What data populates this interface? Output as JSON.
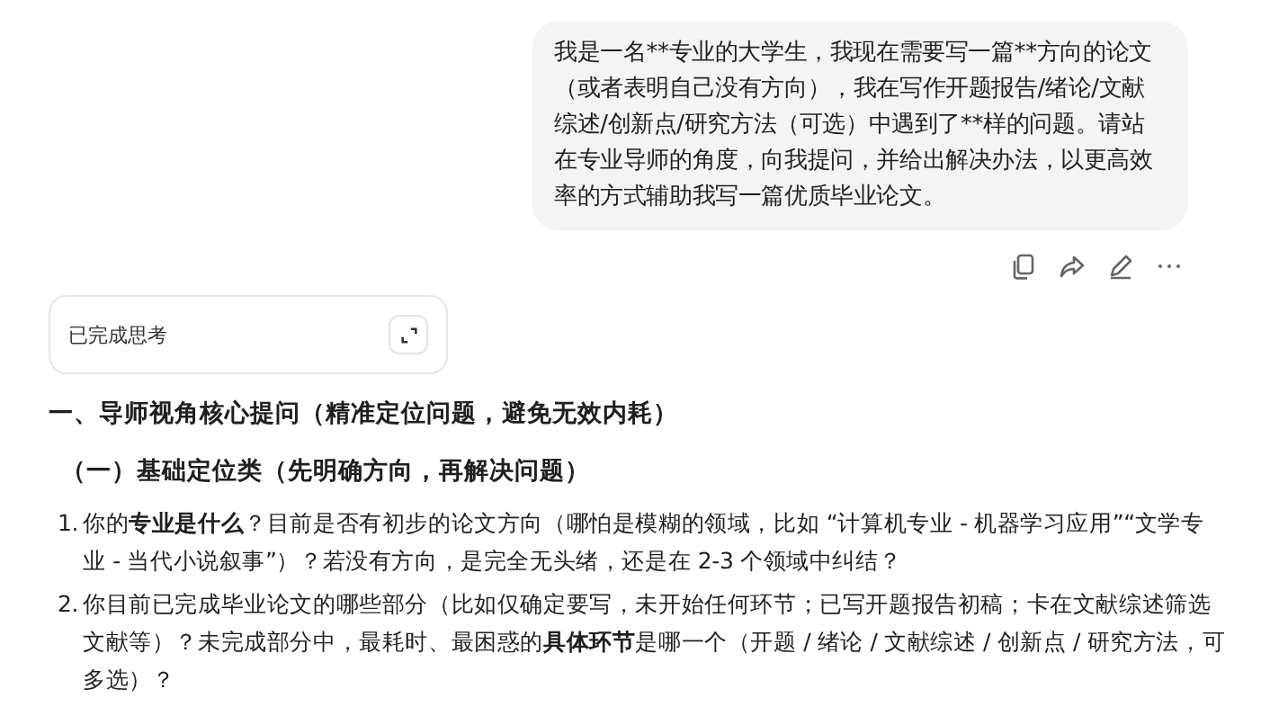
{
  "user_message": {
    "text": "我是一名**专业的大学生，我现在需要写一篇**方向的论文（或者表明自己没有方向），我在写作开题报告/绪论/文献综述/创新点/研究方法（可选）中遇到了**样的问题。请站在专业导师的角度，向我提问，并给出解决办法，以更高效率的方式辅助我写一篇优质毕业论文。"
  },
  "thinking": {
    "label": "已完成思考"
  },
  "answer": {
    "heading": "一、导师视角核心提问（精准定位问题，避免无效内耗）",
    "subheading": "（一）基础定位类（先明确方向，再解决问题）",
    "questions": [
      {
        "number": "1.",
        "text": "你的**专业是什么**？目前是否有初步的论文方向（哪怕是模糊的领域，比如 “计算机专业 - 机器学习应用”“文学专业 - 当代小说叙事”）？若没有方向，是完全无头绪，还是在 2-3 个领域中纠结？"
      },
      {
        "number": "2.",
        "text": "你目前已完成毕业论文的哪些部分（比如仅确定要写，未开始任何环节；已写开题报告初稿；卡在文献综述筛选文献等）？未完成部分中，最耗时、最困惑的**具体环节**是哪一个（开题 / 绪论 / 文献综述 / 创新点 / 研究方法，可多选）？"
      }
    ]
  }
}
